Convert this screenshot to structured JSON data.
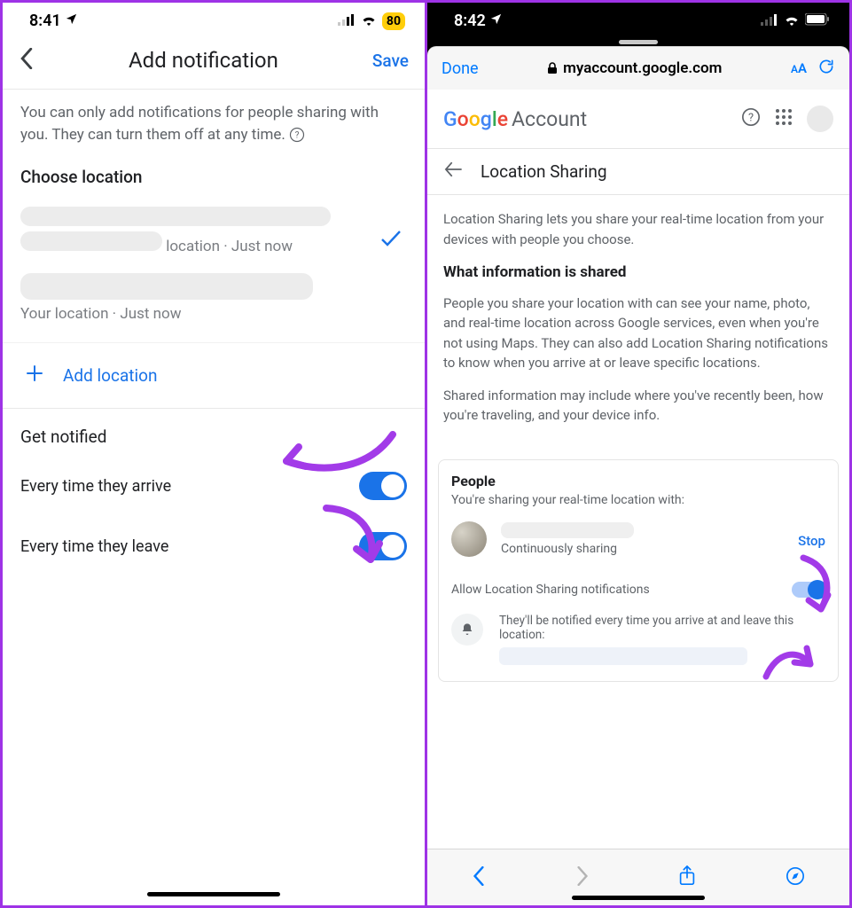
{
  "left": {
    "status": {
      "time": "8:41",
      "battery": "80"
    },
    "header": {
      "title": "Add notification",
      "save": "Save"
    },
    "desc": "You can only add notifications for people sharing with you. They can turn them off at any time.",
    "choose_title": "Choose location",
    "loc1_meta_suffix": "location · Just now",
    "loc2_meta": "Your location · Just now",
    "add_location": "Add location",
    "get_notified": "Get notified",
    "toggle_arrive": "Every time they arrive",
    "toggle_leave": "Every time they leave"
  },
  "right": {
    "status": {
      "time": "8:42"
    },
    "browser": {
      "done": "Done",
      "url": "myaccount.google.com",
      "aa": "AA"
    },
    "logo_google": "Google",
    "logo_account": "Account",
    "ls_title": "Location Sharing",
    "intro": "Location Sharing lets you share your real-time location from your devices with people you choose.",
    "what_heading": "What information is shared",
    "what_p1": "People you share your location with can see your name, photo, and real-time location across Google services, even when you're not using Maps. They can also add Location Sharing notifications to know when you arrive at or leave specific locations.",
    "what_p2": "Shared information may include where you've recently been, how you're traveling, and your device info.",
    "people_title": "People",
    "people_sub": "You're sharing your real-time location with:",
    "cont": "Continuously sharing",
    "stop": "Stop",
    "allow": "Allow Location Sharing notifications",
    "notify_desc": "They'll be notified every time you arrive at and leave this location:"
  }
}
